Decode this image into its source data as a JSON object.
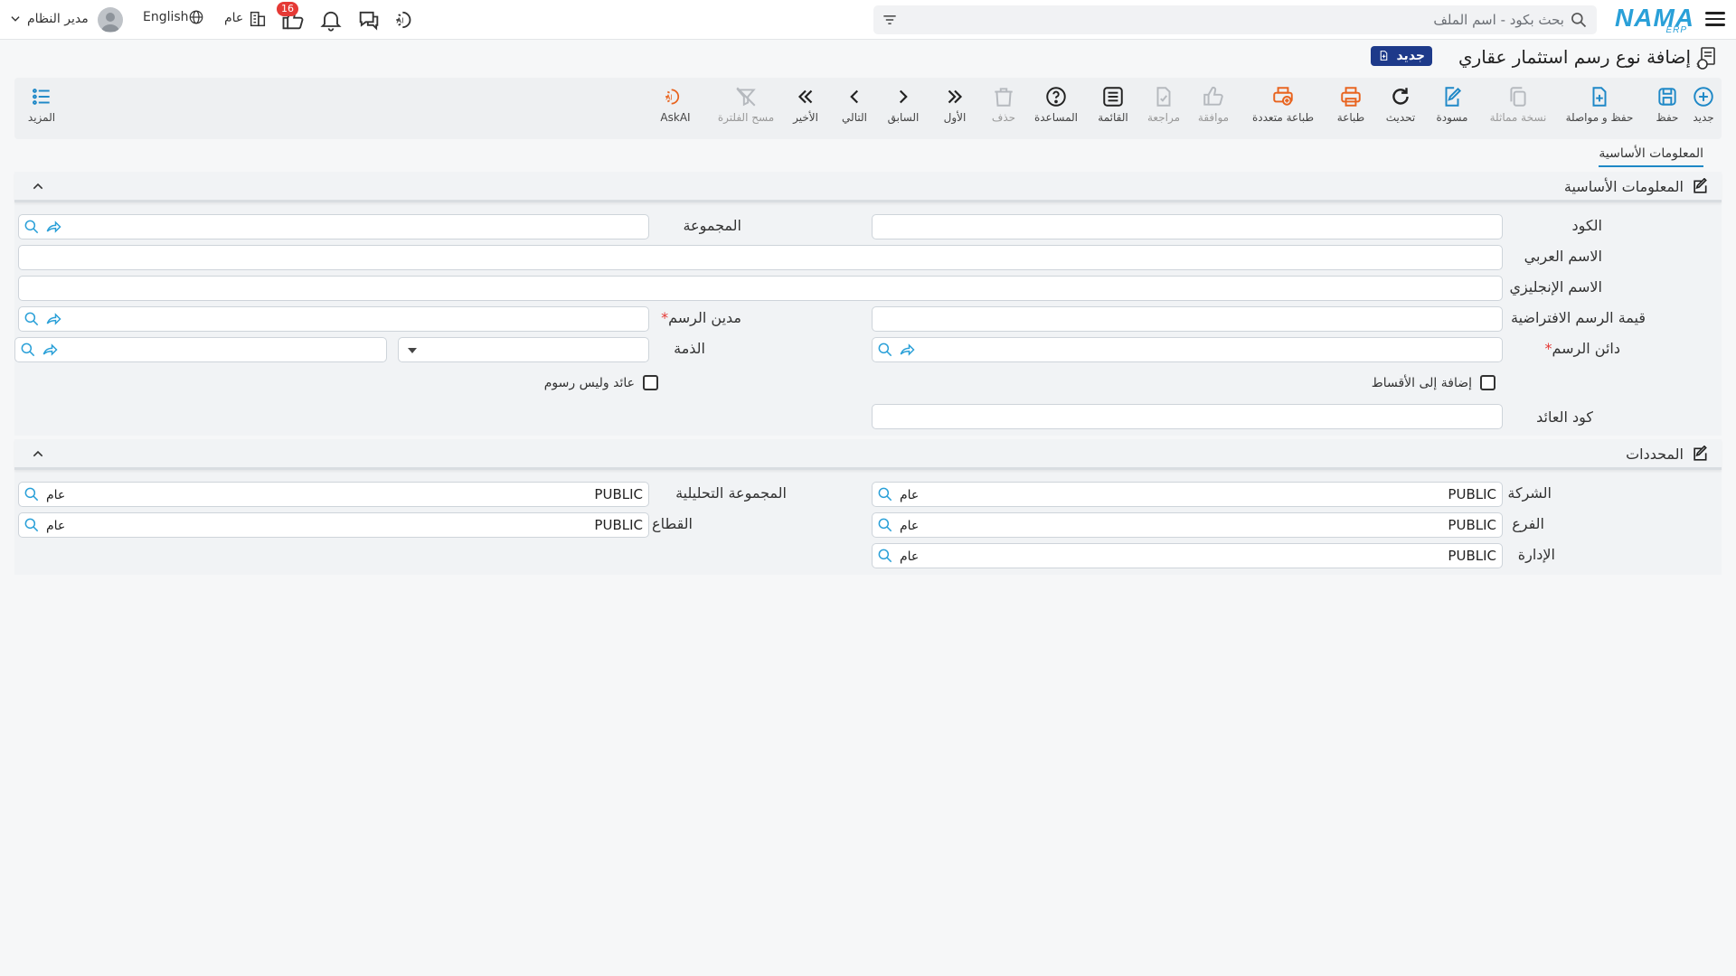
{
  "topbar": {
    "logo_text": "NAMA",
    "logo_sub": "ERP",
    "search_placeholder": "بحث بكود - اسم الملف",
    "notification_count": "16",
    "amm_label": "عام",
    "language_label": "English",
    "user_name": "مدير النظام"
  },
  "header": {
    "title": "إضافة نوع رسم استثمار عقاري",
    "new_badge": "جديد"
  },
  "toolbar": {
    "new": "جديد",
    "save": "حفظ",
    "save_continue": "حفظ و مواصلة",
    "duplicate": "نسخة مماثلة",
    "draft": "مسودة",
    "refresh": "تحديث",
    "print": "طباعة",
    "multi_print": "طباعة متعددة",
    "approve": "موافقة",
    "review": "مراجعة",
    "list": "القائمة",
    "help": "المساعدة",
    "delete": "حذف",
    "first": "الأول",
    "previous": "السابق",
    "next": "التالي",
    "last": "الأخير",
    "clear_filter": "مسح الفلترة",
    "askai": "AskAI",
    "more": "المزيد"
  },
  "tabs": {
    "basic_info": "المعلومات الأساسية"
  },
  "basic_section": {
    "title": "المعلومات الأساسية",
    "code_label": "الكود",
    "group_label": "المجموعة",
    "arabic_name_label": "الاسم العربي",
    "english_name_label": "الاسم الإنجليزي",
    "default_value_label": "قيمة الرسم الافتراضية",
    "debtor_label": "مدين الرسم",
    "creditor_label": "دائن الرسم",
    "liability_label": "الذمة",
    "add_installments_label": "إضافة إلى الأقساط",
    "revenue_not_fee_label": "عائد وليس رسوم",
    "revenue_code_label": "كود العائد"
  },
  "determinants_section": {
    "title": "المحددات",
    "company_label": "الشركة",
    "company_value": "PUBLIC",
    "analysis_group_label": "المجموعة التحليلية",
    "analysis_group_value": "PUBLIC",
    "branch_label": "الفرع",
    "branch_value": "PUBLIC",
    "sector_label": "القطاع",
    "sector_value": "PUBLIC",
    "department_label": "الإدارة",
    "department_value": "PUBLIC",
    "general_tag": "عام"
  },
  "colors": {
    "accent_blue": "#1e88c7",
    "print_orange": "#e8631e",
    "badge_red": "#e53935",
    "new_badge_bg": "#1e3a8a"
  }
}
